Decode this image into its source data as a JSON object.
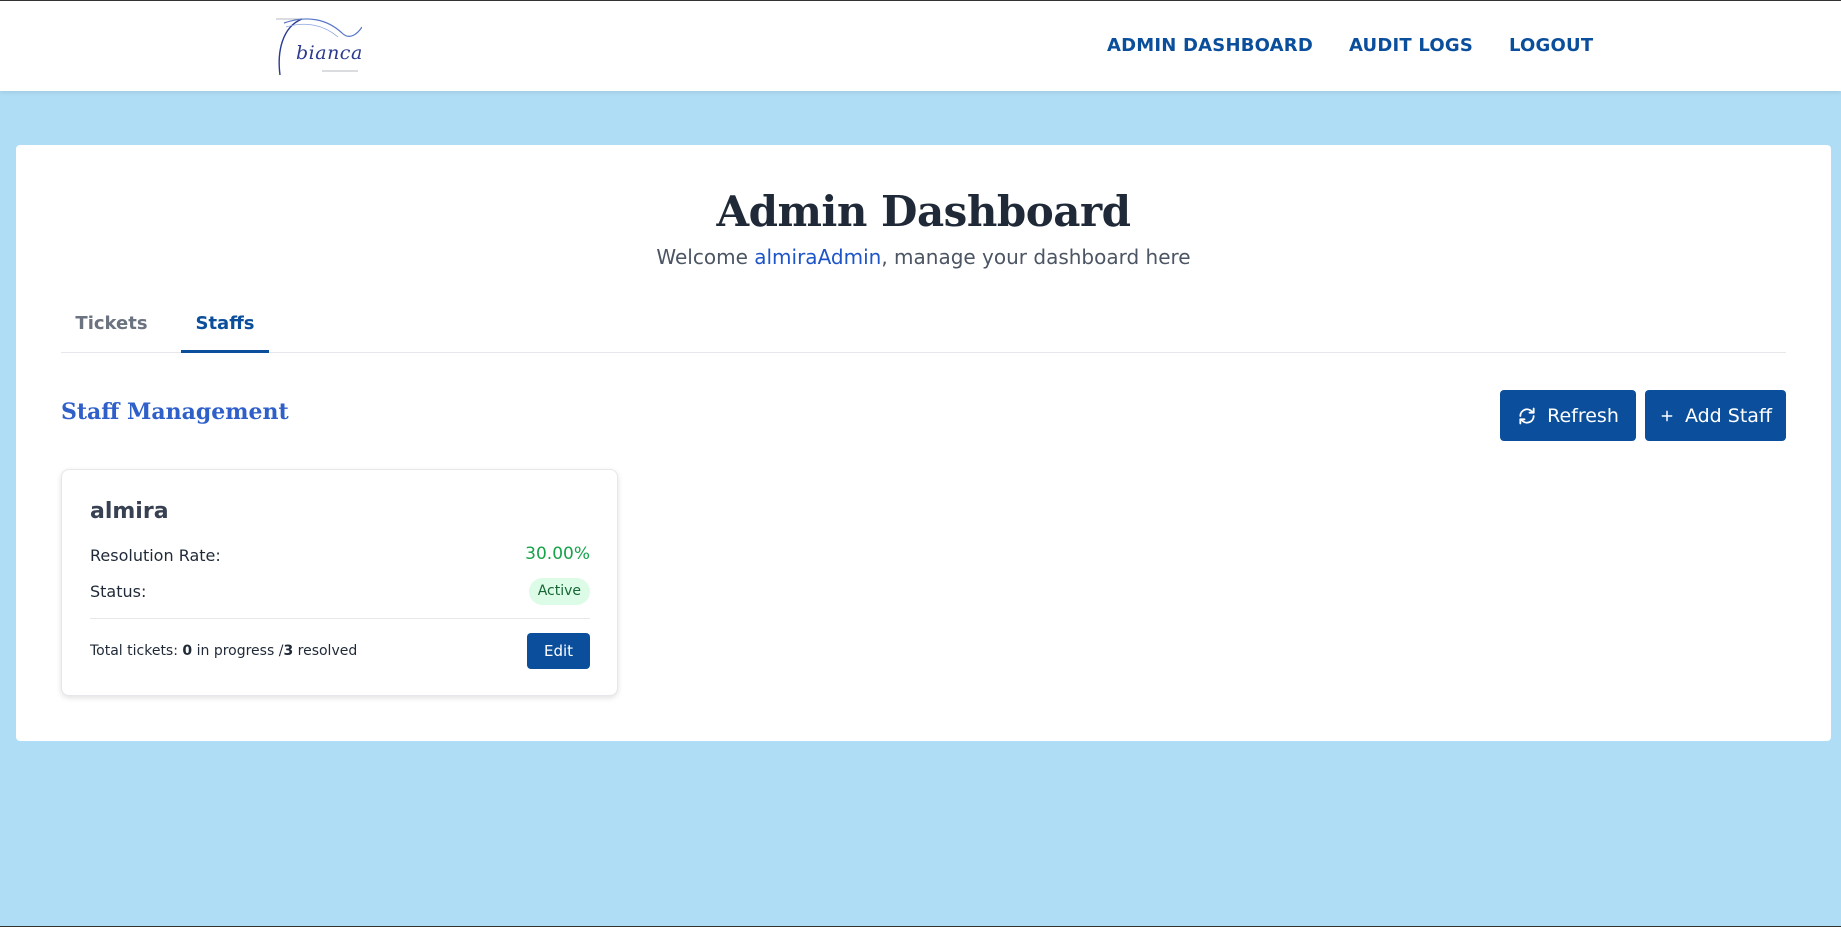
{
  "header": {
    "logo_text": "bianca",
    "nav": {
      "admin_dashboard": "ADMIN DASHBOARD",
      "audit_logs": "AUDIT LOGS",
      "logout": "LOGOUT"
    }
  },
  "main": {
    "title": "Admin Dashboard",
    "welcome_prefix": "Welcome ",
    "username": "almiraAdmin",
    "welcome_suffix": ", manage your dashboard here",
    "tabs": [
      {
        "label": "Tickets",
        "active": false
      },
      {
        "label": "Staffs",
        "active": true
      }
    ],
    "section_title": "Staff Management",
    "refresh_label": "Refresh",
    "add_staff_label": "Add Staff",
    "refresh_icon": "refresh-icon",
    "add_icon": "plus-icon"
  },
  "staff_cards": [
    {
      "name": "almira",
      "resolution_rate_label": "Resolution Rate:",
      "resolution_rate": "30.00%",
      "status_label": "Status:",
      "status": "Active",
      "total_tickets_label": "Total tickets: ",
      "in_progress_count": "0",
      "in_progress_label": " in progress /",
      "resolved_count": "3",
      "resolved_label": " resolved",
      "edit_label": "Edit"
    }
  ],
  "colors": {
    "background": "#b0ddf6",
    "primary": "#0b4f9c",
    "accent_text": "#2f5fc8",
    "success": "#16a34a",
    "badge_bg": "#dcfce7"
  }
}
